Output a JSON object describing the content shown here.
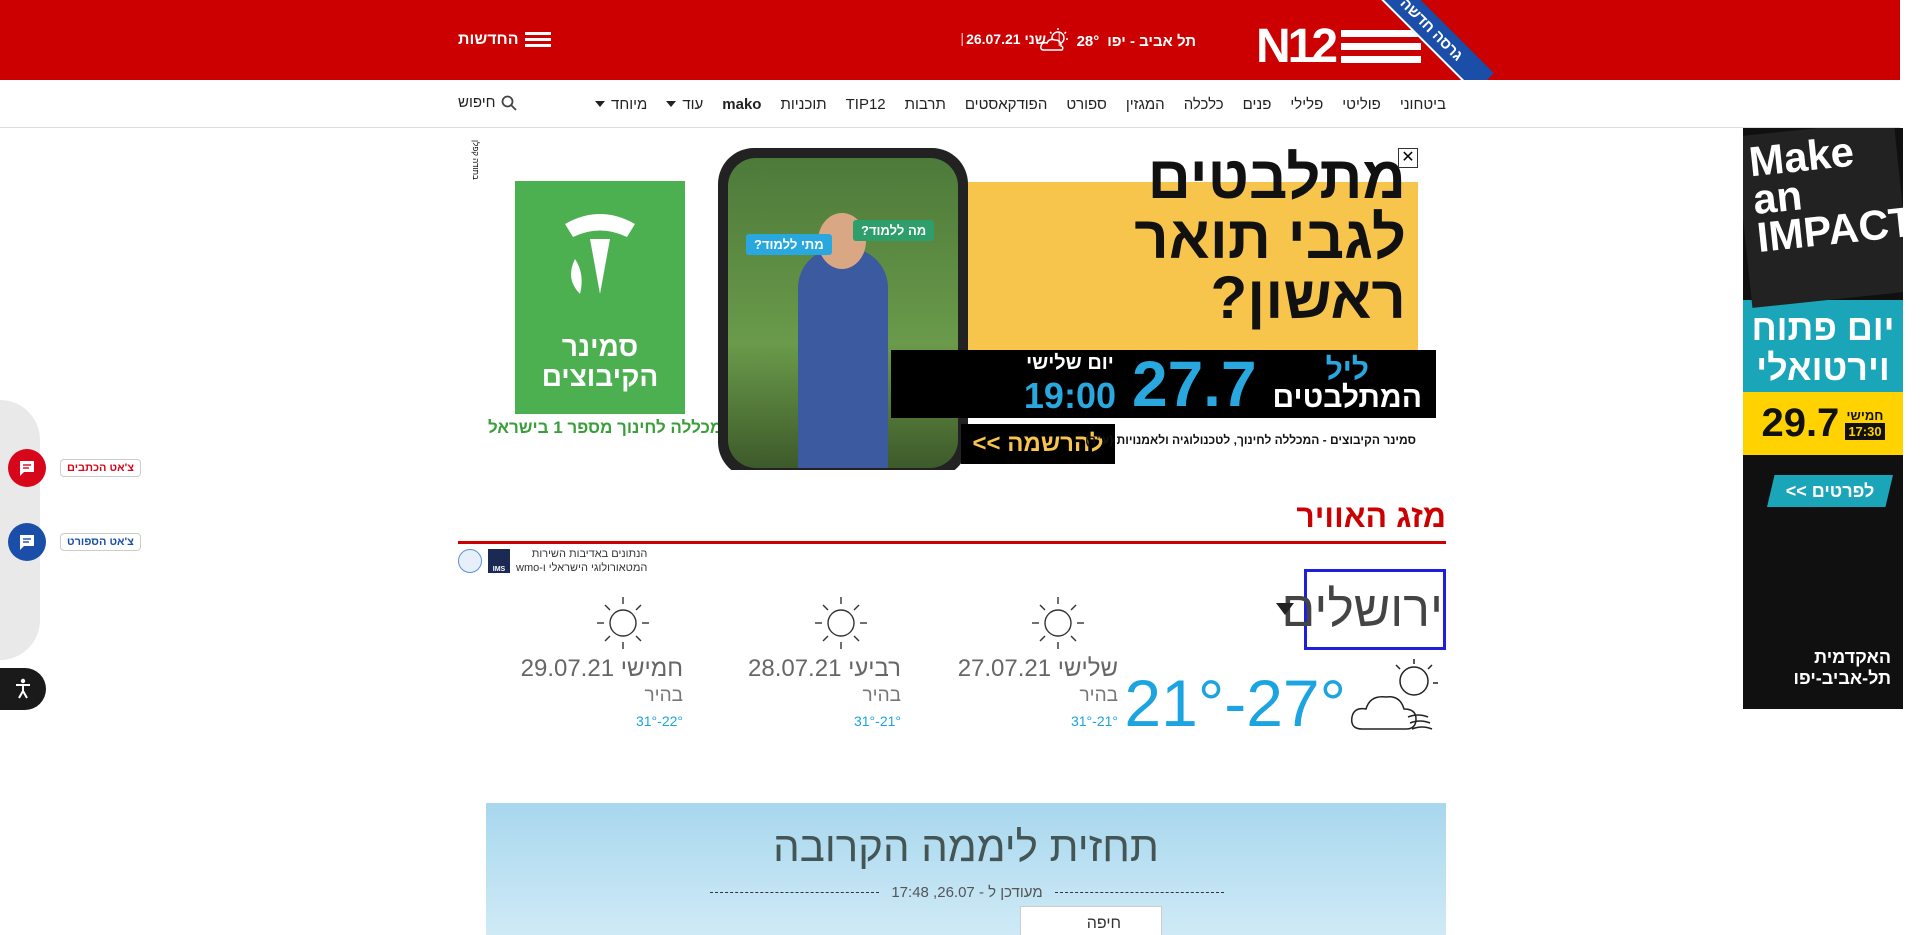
{
  "header": {
    "logo_text": "N12",
    "ribbon": "גרסה חדשה",
    "weather_city": "תל אביב - יפו",
    "weather_temp": "28°",
    "date": "שני 26.07.21",
    "news_label": "החדשות",
    "separator": "|"
  },
  "nav": {
    "items": [
      "ביטחוני",
      "פוליטי",
      "פלילי",
      "פנים",
      "כלכלה",
      "המגזין",
      "ספורט",
      "הפודקאסטים",
      "תרבות",
      "TIP12",
      "תוכניות",
      "mako",
      "עוד",
      "מיוחד"
    ],
    "search_label": "חיפוש"
  },
  "ad": {
    "close_glyph": "✕",
    "title_line1": "מתלבטים",
    "title_line2": "לגבי תואר",
    "title_line3": "ראשון?",
    "event_small": "ליל",
    "event_big": "המתלבטים",
    "event_date": "27.7",
    "event_day": "יום שלישי",
    "event_time": "19:00",
    "cta": "להרשמה >>",
    "note": "סמינר הקיבוצים - המכללה לחינוך, לטכנולוגיה ולאמנויות (ע\"ר)",
    "brand_name": "סמינר הקיבוצים",
    "brand_sub": "המכללה לחינוך מספר 1 בישראל",
    "phone_bubble1": "מה ללמוד?",
    "phone_bubble2": "מתי ללמוד?",
    "tiny": "בתודה קפלן"
  },
  "side_banner": {
    "headline": "Make an IMPACT",
    "open_day": "יום פתוח וירטואלי",
    "date": "29.7",
    "day": "חמישי",
    "time": "17:30",
    "cta": "לפרטים >>",
    "brand": "האקדמית תל-אביב-יפו"
  },
  "chats": {
    "writers": "צ'אט הכתבים",
    "sport": "צ'אט הספורט"
  },
  "weather": {
    "title": "מזג האוויר",
    "source_line1": "הנתונים באדיבות השירות",
    "source_line2": "המטאורולוגי הישראלי ו-wmo",
    "ims": "IMS",
    "city": "ירושלים",
    "today_range": "21°-27°",
    "days": [
      {
        "name": "שלישי 27.07.21",
        "cond": "בהיר",
        "range": "31°-21°"
      },
      {
        "name": "רביעי 28.07.21",
        "cond": "בהיר",
        "range": "31°-21°"
      },
      {
        "name": "חמישי 29.07.21",
        "cond": "בהיר",
        "range": "31°-22°"
      }
    ]
  },
  "forecast": {
    "title": "תחזית ליממה הקרובה",
    "updated": "מעודכן ל - 26.07, 17:48",
    "first_city": "חיפה"
  }
}
